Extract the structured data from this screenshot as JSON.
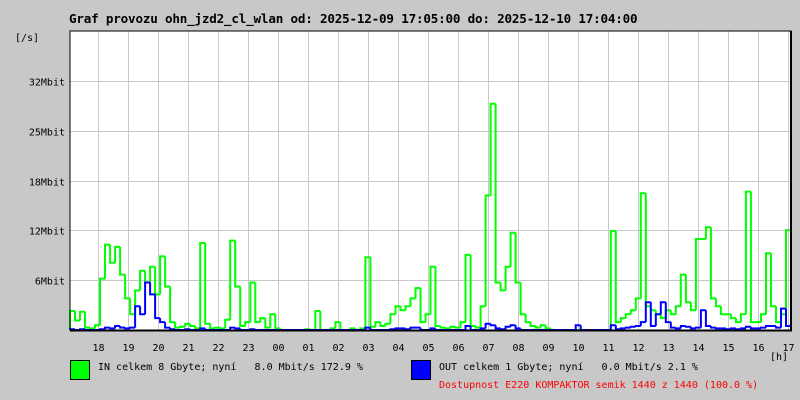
{
  "title": "Graf provozu ohn_jzd2_cl_wlan od: 2025-12-09 17:05:00 do: 2025-12-10 17:04:00",
  "chart_data": {
    "type": "line",
    "title": "Graf provozu ohn_jzd2_cl_wlan od: 2025-12-09 17:05:00 do: 2025-12-10 17:04:00",
    "ylabel": "[/s]",
    "xlabel": "[h]",
    "y_unit": "Mbit/s",
    "ylim": [
      0,
      37.8
    ],
    "y_ticks": [
      {
        "value": 6.3,
        "label": "6Mbit"
      },
      {
        "value": 12.6,
        "label": "12Mbit"
      },
      {
        "value": 18.9,
        "label": "18Mbit"
      },
      {
        "value": 25.2,
        "label": "25Mbit"
      },
      {
        "value": 31.5,
        "label": "32Mbit"
      }
    ],
    "x_start": "2025-12-09 17:05",
    "x_interval_minutes": 10,
    "x_ticks": [
      "18",
      "19",
      "20",
      "21",
      "22",
      "23",
      "00",
      "01",
      "02",
      "03",
      "04",
      "05",
      "06",
      "07",
      "08",
      "09",
      "10",
      "11",
      "12",
      "13",
      "14",
      "15",
      "16",
      "17"
    ],
    "grid": true,
    "series": [
      {
        "name": "IN",
        "color": "#00ff00",
        "values": [
          2.4,
          1.2,
          2.3,
          0.3,
          0.2,
          0.6,
          6.5,
          10.8,
          8.5,
          10.5,
          7,
          4,
          2,
          5,
          7.5,
          6,
          8,
          4.5,
          9.3,
          5.5,
          1,
          0.3,
          0.4,
          0.8,
          0.5,
          0.2,
          11,
          0.8,
          0.2,
          0.3,
          0.2,
          1.3,
          11.3,
          5.5,
          0.5,
          1.0,
          6,
          1,
          1.5,
          0.3,
          2,
          0.2,
          0,
          0,
          0,
          0,
          0,
          0.1,
          0,
          2.4,
          0,
          0,
          0.2,
          1,
          0,
          0,
          0.2,
          0,
          0.2,
          9.2,
          0.4,
          1,
          0.5,
          0.8,
          2,
          3,
          2.5,
          3,
          4,
          5.3,
          1,
          2,
          8,
          0.5,
          0.3,
          0.2,
          0.4,
          0.3,
          1,
          9.5,
          0.5,
          0.3,
          3,
          17,
          28.6,
          6,
          5,
          8,
          12.3,
          6,
          2,
          1,
          0.5,
          0.3,
          0.6,
          0.2,
          0,
          0,
          0,
          0,
          0,
          0,
          0,
          0,
          0,
          0,
          0,
          0,
          12.5,
          1,
          1.5,
          2,
          2.5,
          4,
          17.3,
          3,
          2.5,
          2,
          1.5,
          2.5,
          2,
          3,
          7,
          3.5,
          2.5,
          11.5,
          11.5,
          13,
          4,
          3,
          2,
          2,
          1.5,
          1,
          2,
          17.5,
          1,
          1,
          2,
          9.7,
          3,
          1,
          2,
          12.6
        ]
      },
      {
        "name": "OUT",
        "color": "#0000ff",
        "values": [
          0.1,
          0,
          0.1,
          0,
          0,
          0,
          0.1,
          0.3,
          0.2,
          0.5,
          0.3,
          0.2,
          0.3,
          3,
          2,
          6,
          4.5,
          1.5,
          1,
          0.3,
          0.1,
          0,
          0,
          0.1,
          0,
          0,
          0.2,
          0,
          0,
          0,
          0,
          0,
          0.3,
          0.2,
          0,
          0,
          0.1,
          0,
          0,
          0,
          0,
          0,
          0,
          0,
          0,
          0,
          0,
          0,
          0,
          0,
          0,
          0,
          0,
          0,
          0,
          0,
          0,
          0,
          0,
          0.3,
          0,
          0,
          0,
          0,
          0.1,
          0.2,
          0.2,
          0.1,
          0.3,
          0.3,
          0,
          0,
          0.2,
          0,
          0,
          0,
          0,
          0,
          0,
          0.5,
          0,
          0,
          0.2,
          0.8,
          0.6,
          0.2,
          0.1,
          0.4,
          0.6,
          0.2,
          0,
          0,
          0,
          0,
          0,
          0,
          0,
          0,
          0,
          0,
          0,
          0.6,
          0,
          0,
          0,
          0,
          0,
          0,
          0.6,
          0.1,
          0.2,
          0.3,
          0.4,
          0.5,
          1,
          3.5,
          0.5,
          2,
          3.5,
          1,
          0.3,
          0.2,
          0.5,
          0.4,
          0.2,
          0.3,
          2.5,
          0.5,
          0.3,
          0.2,
          0.2,
          0.1,
          0.2,
          0.1,
          0.2,
          0.4,
          0.2,
          0.2,
          0.3,
          0.5,
          0.5,
          0.3,
          2.7,
          0.5
        ]
      }
    ]
  },
  "legend": {
    "in_text": "IN celkem 8 Gbyte; nyní   8.0 Mbit/s 172.9 %",
    "out_text": "OUT celkem 1 Gbyte; nyní   0.0 Mbit/s 2.1 %",
    "availability": "Dostupnost E220 KOMPAKTOR semik 1440 z 1440 (100.0 %)",
    "in_color": "#00ff00",
    "out_color": "#0000ff",
    "availability_color": "#ff0000"
  }
}
